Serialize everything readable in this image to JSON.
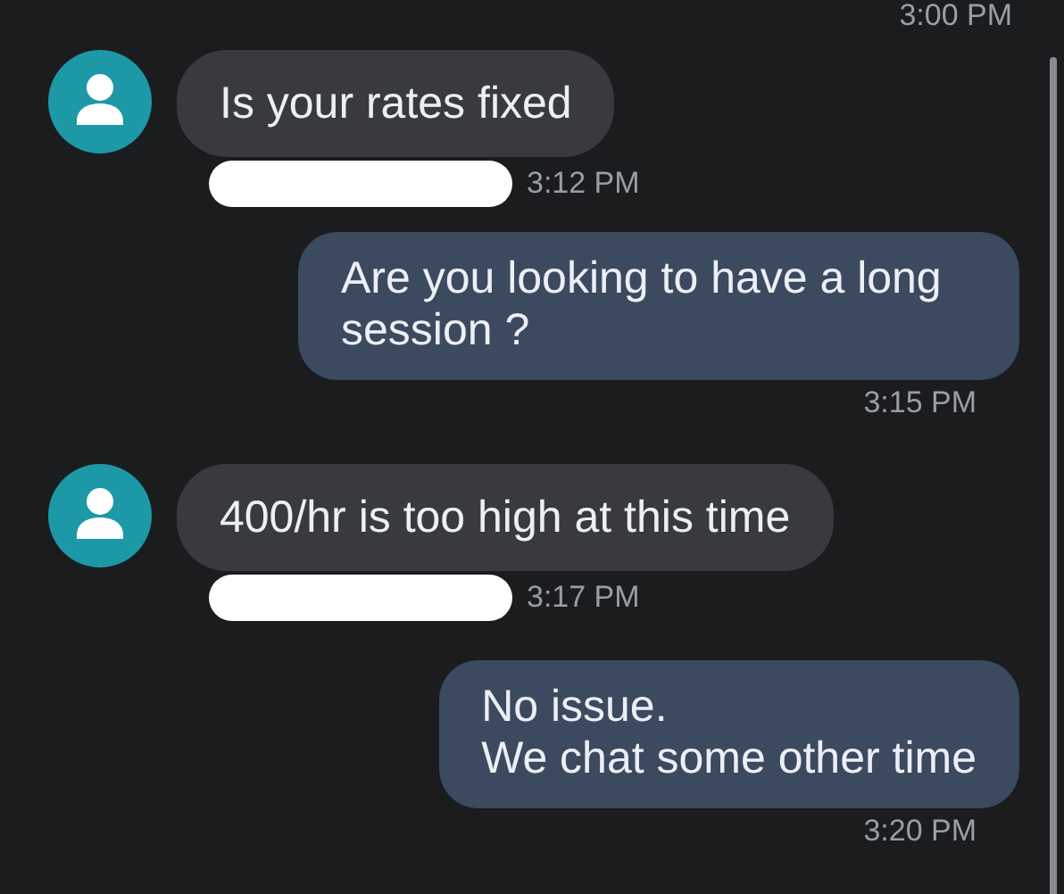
{
  "top_time": "3:00 PM",
  "messages": [
    {
      "kind": "incoming",
      "text": "Is your rates fixed",
      "time": "3:12 PM",
      "redacted": true
    },
    {
      "kind": "outgoing",
      "text": "Are you looking to have a long session ?",
      "time": "3:15 PM"
    },
    {
      "kind": "incoming",
      "text": "400/hr is too high at this time",
      "time": "3:17 PM",
      "redacted": true
    },
    {
      "kind": "outgoing",
      "text": "No issue.\nWe chat some other time",
      "time": "3:20 PM"
    }
  ]
}
